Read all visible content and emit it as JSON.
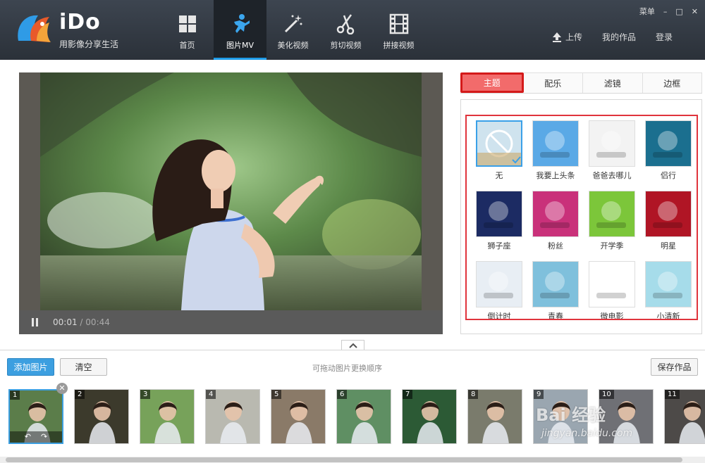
{
  "app": {
    "name": "iDo",
    "tagline": "用影像分享生活"
  },
  "nav": [
    {
      "label": "首页",
      "icon": "home-grid-icon"
    },
    {
      "label": "图片MV",
      "icon": "photo-mv-icon",
      "active": true
    },
    {
      "label": "美化视频",
      "icon": "magic-wand-icon"
    },
    {
      "label": "剪切视频",
      "icon": "scissors-icon"
    },
    {
      "label": "拼接视频",
      "icon": "film-strip-icon"
    }
  ],
  "window": {
    "menu": "菜单",
    "minimize": "–",
    "maximize": "□",
    "close": "✕"
  },
  "account": {
    "upload": "上传",
    "my_works": "我的作品",
    "login": "登录"
  },
  "player": {
    "current_time": "00:01",
    "separator": "/",
    "total_time": "00:44",
    "progress": 0.02
  },
  "tabs": [
    {
      "label": "主题",
      "active": true
    },
    {
      "label": "配乐"
    },
    {
      "label": "滤镜"
    },
    {
      "label": "边框"
    }
  ],
  "themes": [
    {
      "name": "无",
      "selected": true,
      "color": "#cfe3ee"
    },
    {
      "name": "我要上头条",
      "color": "#5aa9e6"
    },
    {
      "name": "爸爸去哪儿",
      "color": "#f3f3f3"
    },
    {
      "name": "侣行",
      "color": "#1b6f8f"
    },
    {
      "name": "狮子座",
      "color": "#1c2b63"
    },
    {
      "name": "粉丝",
      "color": "#c9317a"
    },
    {
      "name": "开学季",
      "color": "#7cc63a"
    },
    {
      "name": "明星",
      "color": "#b01525"
    },
    {
      "name": "倒计时",
      "color": "#e8eef4"
    },
    {
      "name": "青春",
      "color": "#7fc0dc"
    },
    {
      "name": "微电影",
      "color": "#ffffff"
    },
    {
      "name": "小清新",
      "color": "#a6dcea"
    }
  ],
  "actions": {
    "add_photo": "添加图片",
    "clear": "清空",
    "hint": "可拖动图片更换顺序",
    "save": "保存作品"
  },
  "thumbs": [
    {
      "num": "1",
      "color": "#5b7d4a"
    },
    {
      "num": "2",
      "color": "#3c3a2c"
    },
    {
      "num": "3",
      "color": "#77a25a"
    },
    {
      "num": "4",
      "color": "#b9b9b0"
    },
    {
      "num": "5",
      "color": "#8a7a68"
    },
    {
      "num": "6",
      "color": "#5f8f63"
    },
    {
      "num": "7",
      "color": "#2c5a35"
    },
    {
      "num": "8",
      "color": "#7a7b6c"
    },
    {
      "num": "9",
      "color": "#9aa6b0"
    },
    {
      "num": "10",
      "color": "#6f7075"
    },
    {
      "num": "11",
      "color": "#4d4a48"
    }
  ],
  "thumb_tools": {
    "rotate_left": "↶",
    "rotate_right": "↷"
  },
  "watermark": {
    "line1": "Bai 经验",
    "line2": "jingyan.baidu.com"
  }
}
